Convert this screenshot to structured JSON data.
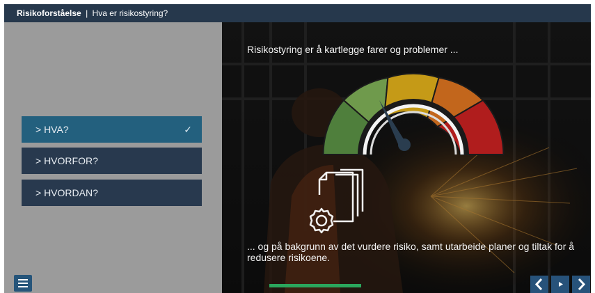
{
  "header": {
    "course": "Risikoforståelse",
    "separator": "|",
    "chapter": "Hva er risikostyring?"
  },
  "menu": {
    "items": [
      {
        "label": "> HVA?",
        "active": true,
        "check": "✓"
      },
      {
        "label": "> HVORFOR?",
        "active": false
      },
      {
        "label": "> HVORDAN?",
        "active": false
      }
    ]
  },
  "slide": {
    "heading": "Risikostyring er å kartlegge farer og problemer ...",
    "caption": "... og på bakgrunn av det vurdere risiko, samt utarbeide planer og tiltak for å redusere risikoene.",
    "gauge_colors": [
      "#4f7f3c",
      "#6f9a4c",
      "#c59a17",
      "#c2661c",
      "#b01d1d"
    ],
    "progress_fraction": 0.33
  },
  "controls": {
    "icons": [
      "menu-icon",
      "chevron-left-icon",
      "play-icon",
      "chevron-right-icon"
    ],
    "accent_color": "#27527a",
    "progress_color": "#2aa65c"
  }
}
